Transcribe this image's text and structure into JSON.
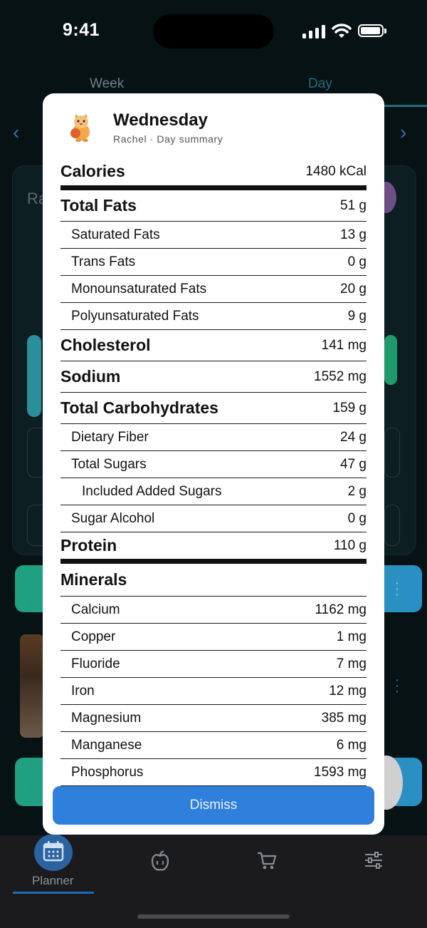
{
  "status": {
    "time": "9:41"
  },
  "background": {
    "tabs": [
      {
        "label": "Week"
      },
      {
        "label": "Day"
      }
    ],
    "card_label": "Ra"
  },
  "tabbar": {
    "planner_label": "Planner"
  },
  "modal": {
    "title": "Wednesday",
    "subtitle": "Rachel · Day summary",
    "nutrients": [
      {
        "label": "Calories",
        "value": "1480 kCal",
        "style": "first"
      },
      {
        "label": "Total Fats",
        "value": "51 g",
        "style": "major"
      },
      {
        "label": "Saturated Fats",
        "value": "13 g",
        "style": "minor"
      },
      {
        "label": "Trans Fats",
        "value": "0 g",
        "style": "minor"
      },
      {
        "label": "Monounsaturated Fats",
        "value": "20 g",
        "style": "minor"
      },
      {
        "label": "Polyunsaturated Fats",
        "value": "9 g",
        "style": "minor"
      },
      {
        "label": "Cholesterol",
        "value": "141 mg",
        "style": "major"
      },
      {
        "label": "Sodium",
        "value": "1552 mg",
        "style": "major"
      },
      {
        "label": "Total Carbohydrates",
        "value": "159 g",
        "style": "major"
      },
      {
        "label": "Dietary Fiber",
        "value": "24 g",
        "style": "minor"
      },
      {
        "label": "Total Sugars",
        "value": "47 g",
        "style": "minor"
      },
      {
        "label": "Included Added Sugars",
        "value": "2 g",
        "style": "minor2"
      },
      {
        "label": "Sugar Alcohol",
        "value": "0 g",
        "style": "minor"
      },
      {
        "label": "Protein",
        "value": "110 g",
        "style": "thick"
      },
      {
        "label": "Minerals",
        "value": "",
        "style": "header"
      },
      {
        "label": "Calcium",
        "value": "1162 mg",
        "style": "minor"
      },
      {
        "label": "Copper",
        "value": "1 mg",
        "style": "minor"
      },
      {
        "label": "Fluoride",
        "value": "7 mg",
        "style": "minor"
      },
      {
        "label": "Iron",
        "value": "12 mg",
        "style": "minor"
      },
      {
        "label": "Magnesium",
        "value": "385 mg",
        "style": "minor"
      },
      {
        "label": "Manganese",
        "value": "6 mg",
        "style": "minor"
      },
      {
        "label": "Phosphorus",
        "value": "1593 mg",
        "style": "minor"
      }
    ],
    "dismiss_label": "Dismiss"
  },
  "colors": {
    "accent": "#2f7fdc",
    "background": "#071215"
  }
}
